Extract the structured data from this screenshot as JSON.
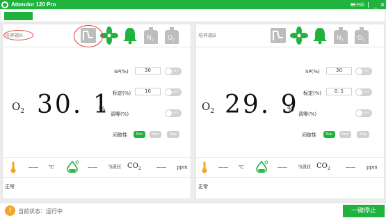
{
  "app": {
    "title": "Attendor 120 Pro",
    "menu_label": "开始",
    "minimize": "_",
    "close": "✕"
  },
  "colors": {
    "accent": "#1fb23d",
    "disabled_icon": "#bdbdbd",
    "annotation": "#e23b3b",
    "warning": "#f4a521"
  },
  "icons": [
    "graph-icon",
    "fan-icon",
    "bell-icon",
    "n2-cylinder-icon",
    "o2-cylinder-icon"
  ],
  "panels": [
    {
      "name": "培养箱A",
      "o2_label": "O",
      "o2_sub": "2",
      "o2_value": "30. 1",
      "o2_unit": "%",
      "sp_label": "SP(%)",
      "sp_value": "30",
      "sp_toggle": "OFF",
      "calib_label": "标定(%)",
      "calib_value": "10",
      "calib_toggle": "OFF",
      "zero_label": "调零(%)",
      "zero_toggle": "OFF",
      "intermittent_label": "间歇性",
      "mode_buttons": [
        "Run",
        "Next",
        "Stop"
      ],
      "n2_icon_text": "N",
      "n2_icon_sub": "2",
      "o2_icon_text": "O",
      "o2_icon_sub": "2",
      "temp_value": "——",
      "temp_unit": "℃",
      "humidity_value": "——",
      "humidity_unit": "%RH",
      "co2_label": "CO",
      "co2_sub": "2",
      "co2_value": "——",
      "co2_unit": "ppm",
      "status": "正常"
    },
    {
      "name": "培养箱B",
      "o2_label": "O",
      "o2_sub": "2",
      "o2_value": "29. 9",
      "o2_unit": "%",
      "sp_label": "SP(%)",
      "sp_value": "30",
      "sp_toggle": "OFF",
      "calib_label": "标定(%)",
      "calib_value": "0. 1",
      "calib_toggle": "OFF",
      "zero_label": "调零(%)",
      "zero_toggle": "OFF",
      "intermittent_label": "间歇性",
      "mode_buttons": [
        "Run",
        "Next",
        "Stop"
      ],
      "n2_icon_text": "N",
      "n2_icon_sub": "2",
      "o2_icon_text": "O",
      "o2_icon_sub": "2",
      "temp_value": "——",
      "temp_unit": "℃",
      "humidity_value": "——",
      "humidity_unit": "%RH",
      "co2_label": "CO",
      "co2_sub": "2",
      "co2_value": "——",
      "co2_unit": "ppm",
      "status": "正常"
    }
  ],
  "footer": {
    "status_icon_text": "!",
    "status_text": "当前状态：运行中",
    "stop_button": "一键停止"
  }
}
